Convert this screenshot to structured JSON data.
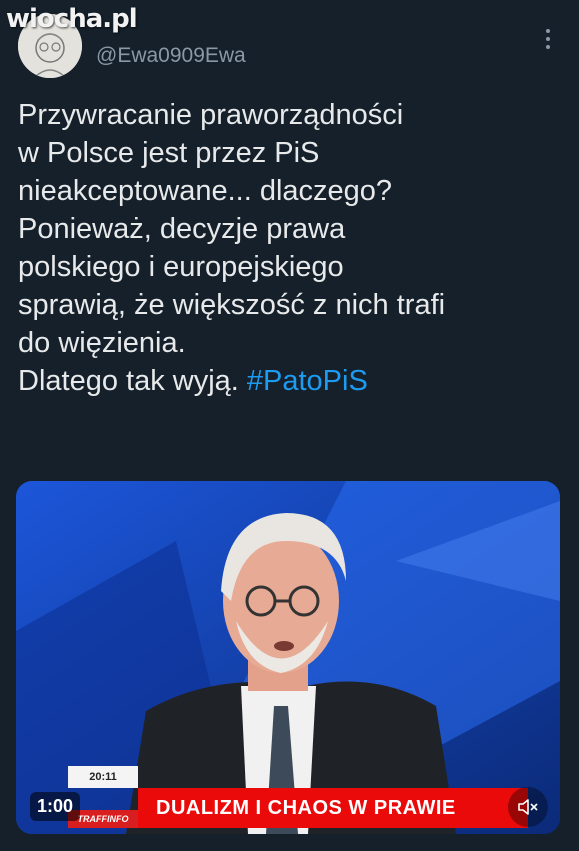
{
  "watermark": "wiocha.pl",
  "author": {
    "handle": "@Ewa0909Ewa"
  },
  "tweet": {
    "lines": [
      "Przywracanie praworządności",
      "w Polsce jest przez PiS",
      "nieakceptowane... dlaczego?",
      "Ponieważ, decyzje prawa",
      "polskiego i europejskiego",
      "sprawią, że większość z nich trafi",
      "do więzienia."
    ],
    "last_line_text": "Dlatego tak wyją. ",
    "hashtag": "#PatoPiS"
  },
  "video": {
    "duration": "1:00",
    "clock": "20:11",
    "channel": "TRAFFINFO",
    "headline": "DUALIZM I CHAOS W PRAWIE",
    "mute_icon": "speaker-muted-icon"
  },
  "colors": {
    "background": "#15202b",
    "text": "#e7e9ea",
    "secondary": "#8b98a5",
    "hashtag": "#1d9bf0",
    "banner_red": "#ea0a0a"
  }
}
